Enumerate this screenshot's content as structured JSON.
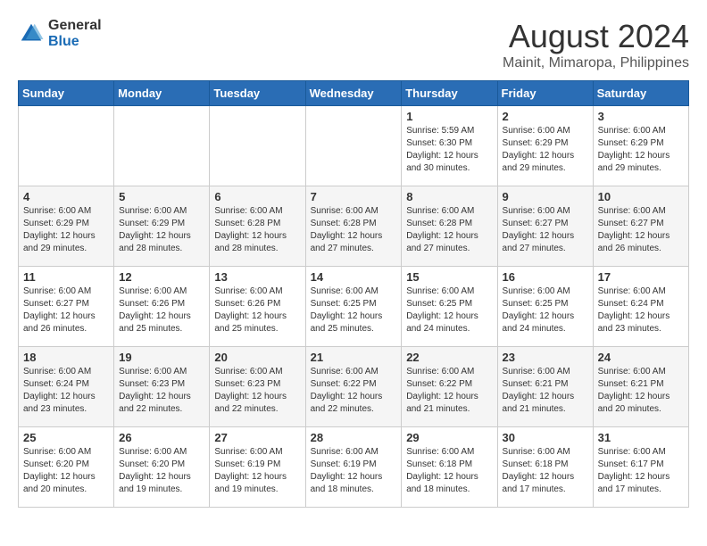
{
  "header": {
    "logo_general": "General",
    "logo_blue": "Blue",
    "month_title": "August 2024",
    "location": "Mainit, Mimaropa, Philippines"
  },
  "days_of_week": [
    "Sunday",
    "Monday",
    "Tuesday",
    "Wednesday",
    "Thursday",
    "Friday",
    "Saturday"
  ],
  "weeks": [
    {
      "days": [
        {
          "number": "",
          "info": ""
        },
        {
          "number": "",
          "info": ""
        },
        {
          "number": "",
          "info": ""
        },
        {
          "number": "",
          "info": ""
        },
        {
          "number": "1",
          "sunrise": "5:59 AM",
          "sunset": "6:30 PM",
          "daylight": "12 hours and 30 minutes."
        },
        {
          "number": "2",
          "sunrise": "6:00 AM",
          "sunset": "6:29 PM",
          "daylight": "12 hours and 29 minutes."
        },
        {
          "number": "3",
          "sunrise": "6:00 AM",
          "sunset": "6:29 PM",
          "daylight": "12 hours and 29 minutes."
        }
      ]
    },
    {
      "days": [
        {
          "number": "4",
          "sunrise": "6:00 AM",
          "sunset": "6:29 PM",
          "daylight": "12 hours and 29 minutes."
        },
        {
          "number": "5",
          "sunrise": "6:00 AM",
          "sunset": "6:29 PM",
          "daylight": "12 hours and 28 minutes."
        },
        {
          "number": "6",
          "sunrise": "6:00 AM",
          "sunset": "6:28 PM",
          "daylight": "12 hours and 28 minutes."
        },
        {
          "number": "7",
          "sunrise": "6:00 AM",
          "sunset": "6:28 PM",
          "daylight": "12 hours and 27 minutes."
        },
        {
          "number": "8",
          "sunrise": "6:00 AM",
          "sunset": "6:28 PM",
          "daylight": "12 hours and 27 minutes."
        },
        {
          "number": "9",
          "sunrise": "6:00 AM",
          "sunset": "6:27 PM",
          "daylight": "12 hours and 27 minutes."
        },
        {
          "number": "10",
          "sunrise": "6:00 AM",
          "sunset": "6:27 PM",
          "daylight": "12 hours and 26 minutes."
        }
      ]
    },
    {
      "days": [
        {
          "number": "11",
          "sunrise": "6:00 AM",
          "sunset": "6:27 PM",
          "daylight": "12 hours and 26 minutes."
        },
        {
          "number": "12",
          "sunrise": "6:00 AM",
          "sunset": "6:26 PM",
          "daylight": "12 hours and 25 minutes."
        },
        {
          "number": "13",
          "sunrise": "6:00 AM",
          "sunset": "6:26 PM",
          "daylight": "12 hours and 25 minutes."
        },
        {
          "number": "14",
          "sunrise": "6:00 AM",
          "sunset": "6:25 PM",
          "daylight": "12 hours and 25 minutes."
        },
        {
          "number": "15",
          "sunrise": "6:00 AM",
          "sunset": "6:25 PM",
          "daylight": "12 hours and 24 minutes."
        },
        {
          "number": "16",
          "sunrise": "6:00 AM",
          "sunset": "6:25 PM",
          "daylight": "12 hours and 24 minutes."
        },
        {
          "number": "17",
          "sunrise": "6:00 AM",
          "sunset": "6:24 PM",
          "daylight": "12 hours and 23 minutes."
        }
      ]
    },
    {
      "days": [
        {
          "number": "18",
          "sunrise": "6:00 AM",
          "sunset": "6:24 PM",
          "daylight": "12 hours and 23 minutes."
        },
        {
          "number": "19",
          "sunrise": "6:00 AM",
          "sunset": "6:23 PM",
          "daylight": "12 hours and 22 minutes."
        },
        {
          "number": "20",
          "sunrise": "6:00 AM",
          "sunset": "6:23 PM",
          "daylight": "12 hours and 22 minutes."
        },
        {
          "number": "21",
          "sunrise": "6:00 AM",
          "sunset": "6:22 PM",
          "daylight": "12 hours and 22 minutes."
        },
        {
          "number": "22",
          "sunrise": "6:00 AM",
          "sunset": "6:22 PM",
          "daylight": "12 hours and 21 minutes."
        },
        {
          "number": "23",
          "sunrise": "6:00 AM",
          "sunset": "6:21 PM",
          "daylight": "12 hours and 21 minutes."
        },
        {
          "number": "24",
          "sunrise": "6:00 AM",
          "sunset": "6:21 PM",
          "daylight": "12 hours and 20 minutes."
        }
      ]
    },
    {
      "days": [
        {
          "number": "25",
          "sunrise": "6:00 AM",
          "sunset": "6:20 PM",
          "daylight": "12 hours and 20 minutes."
        },
        {
          "number": "26",
          "sunrise": "6:00 AM",
          "sunset": "6:20 PM",
          "daylight": "12 hours and 19 minutes."
        },
        {
          "number": "27",
          "sunrise": "6:00 AM",
          "sunset": "6:19 PM",
          "daylight": "12 hours and 19 minutes."
        },
        {
          "number": "28",
          "sunrise": "6:00 AM",
          "sunset": "6:19 PM",
          "daylight": "12 hours and 18 minutes."
        },
        {
          "number": "29",
          "sunrise": "6:00 AM",
          "sunset": "6:18 PM",
          "daylight": "12 hours and 18 minutes."
        },
        {
          "number": "30",
          "sunrise": "6:00 AM",
          "sunset": "6:18 PM",
          "daylight": "12 hours and 17 minutes."
        },
        {
          "number": "31",
          "sunrise": "6:00 AM",
          "sunset": "6:17 PM",
          "daylight": "12 hours and 17 minutes."
        }
      ]
    }
  ]
}
